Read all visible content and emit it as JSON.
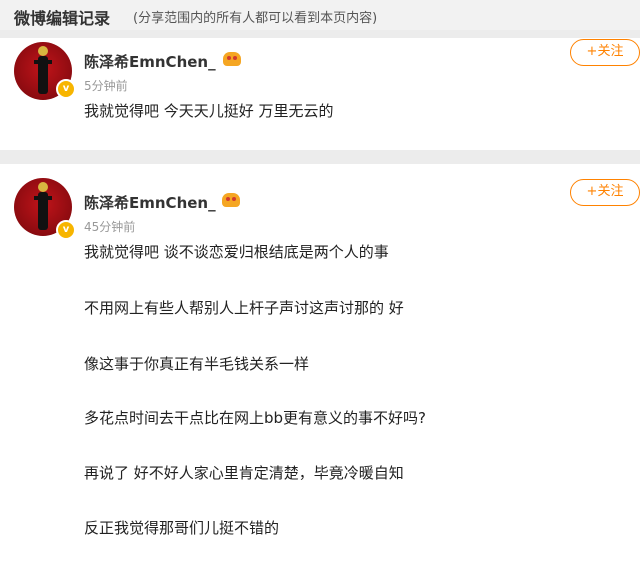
{
  "header": {
    "title": "微博编辑记录",
    "subtitle": "(分享范围内的所有人都可以看到本页内容)"
  },
  "posts": [
    {
      "username": "陈泽希EmnChen_",
      "timestamp": "5分钟前",
      "follow_label": "+关注",
      "lines": [
        "我就觉得吧 今天天儿挺好 万里无云的"
      ]
    },
    {
      "username": "陈泽希EmnChen_",
      "timestamp": "45分钟前",
      "follow_label": "+关注",
      "lines": [
        "我就觉得吧 谈不谈恋爱归根结底是两个人的事",
        "不用网上有些人帮别人上杆子声讨这声讨那的 好",
        "像这事于你真正有半毛钱关系一样",
        "多花点时间去干点比在网上bb更有意义的事不好吗?",
        "再说了 好不好人家心里肯定清楚，毕竟冷暖自知",
        "反正我觉得那哥们儿挺不错的"
      ]
    }
  ],
  "colors": {
    "accent": "#ff8200",
    "verified": "#f7b500",
    "background": "#ececec"
  },
  "icons": {
    "verified": "verified-icon",
    "vip_badge": "vip-badge-icon",
    "avatar": "avatar"
  }
}
